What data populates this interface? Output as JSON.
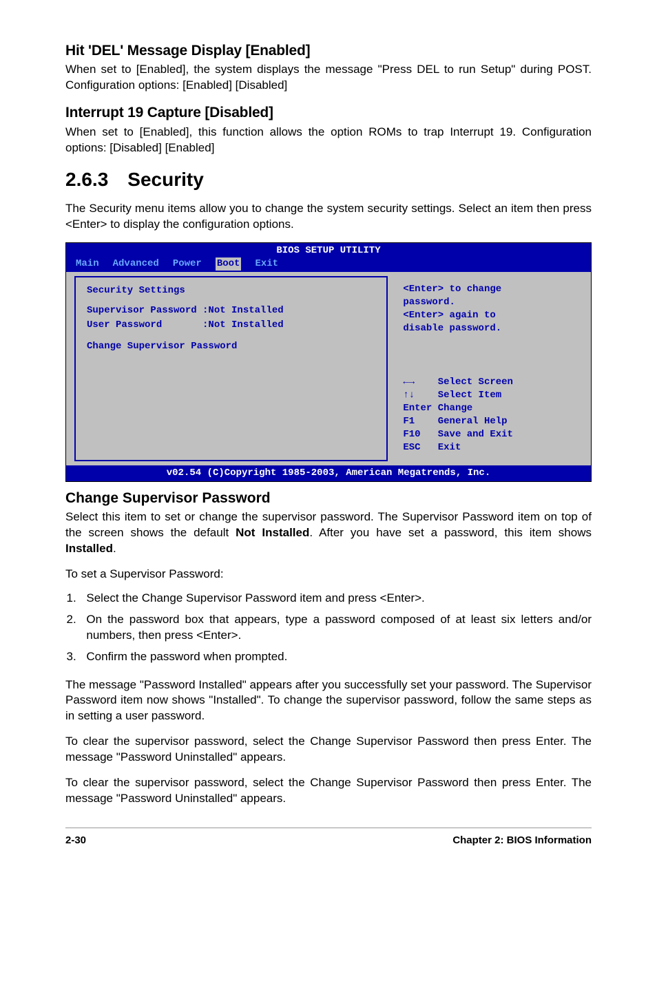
{
  "sec1": {
    "title": "Hit 'DEL' Message Display [Enabled]",
    "body": "When set to [Enabled], the system displays the message \"Press DEL to run Setup\" during POST. Configuration options: [Enabled] [Disabled]"
  },
  "sec2": {
    "title": "Interrupt 19 Capture [Disabled]",
    "body": "When set to [Enabled], this function allows the option ROMs to trap Interrupt 19. Configuration options: [Disabled] [Enabled]"
  },
  "section_heading": "2.6.3 Security",
  "section_intro": "The Security menu items allow you to change the system security settings. Select an item then press <Enter> to display the configuration options.",
  "bios": {
    "title": "BIOS SETUP UTILITY",
    "tabs": [
      "Main",
      "Advanced",
      "Power",
      "Boot",
      "Exit"
    ],
    "selected_tab_index": 3,
    "left": {
      "header": "Security Settings",
      "rows": [
        "Supervisor Password :Not Installed",
        "User Password       :Not Installed"
      ],
      "change": "Change Supervisor Password"
    },
    "right_top": "<Enter> to change\npassword.\n<Enter> again to\ndisable password.",
    "right_bot": "←→    Select Screen\n↑↓    Select Item\nEnter Change\nF1    General Help\nF10   Save and Exit\nESC   Exit",
    "footer": "v02.54 (C)Copyright 1985-2003, American Megatrends, Inc."
  },
  "change_pw": {
    "title": "Change Supervisor Password",
    "p1_a": "Select this item to set or change the supervisor password. The Supervisor Password item on top of the screen shows the default ",
    "p1_b": "Not Installed",
    "p1_c": ". After you have set a password, this item shows ",
    "p1_d": "Installed",
    "p1_e": ".",
    "p2": "To set a Supervisor Password:",
    "steps": [
      "Select the Change Supervisor Password item and press <Enter>.",
      "On the password box that appears, type a password composed of at least six letters and/or numbers, then press <Enter>.",
      "Confirm the password when prompted."
    ],
    "p3": "The message \"Password Installed\" appears after you successfully set your password. The Supervisor Password item now shows \"Installed\". To change the supervisor password, follow the same steps as in setting a user password.",
    "p4": "To clear the supervisor password, select the Change Supervisor Password then press Enter. The message \"Password Uninstalled\" appears.",
    "p5": "To clear the supervisor password, select the Change Supervisor Password then press Enter. The message \"Password Uninstalled\" appears."
  },
  "footer": {
    "left": "2-30",
    "right": "Chapter 2: BIOS Information"
  }
}
